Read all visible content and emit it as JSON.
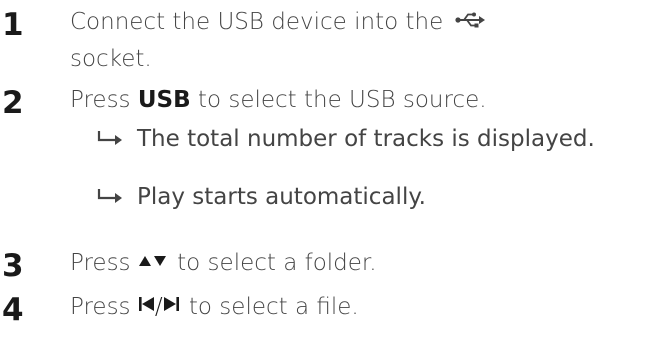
{
  "steps": [
    {
      "number": "1",
      "line1": "Connect the USB device into the",
      "line2": "socket.",
      "icon": "usb-icon"
    },
    {
      "number": "2",
      "pre": "Press ",
      "bold": "USB",
      "post": " to select the USB source.",
      "results": [
        "The total number of tracks is displayed.",
        "Play starts automatically."
      ]
    },
    {
      "number": "3",
      "pre": "Press ",
      "post": " to select a folder.",
      "icon": "up-down-arrows-icon"
    },
    {
      "number": "4",
      "pre": "Press ",
      "separator": "/",
      "post": " to select a file.",
      "icons": [
        "skip-previous-icon",
        "skip-next-icon"
      ]
    }
  ],
  "colors": {
    "number": "#1a1a1a",
    "text": "#444444"
  }
}
